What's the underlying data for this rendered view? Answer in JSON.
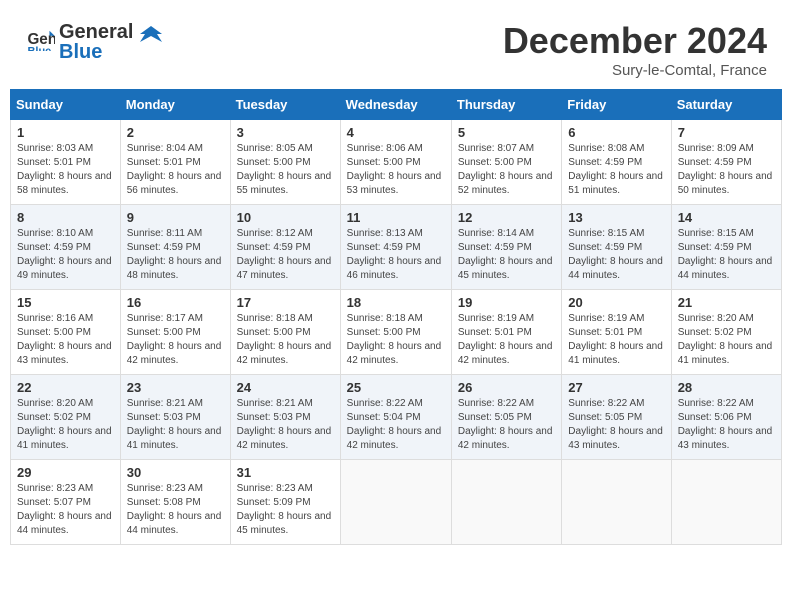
{
  "header": {
    "logo_general": "General",
    "logo_blue": "Blue",
    "month": "December 2024",
    "location": "Sury-le-Comtal, France"
  },
  "weekdays": [
    "Sunday",
    "Monday",
    "Tuesday",
    "Wednesday",
    "Thursday",
    "Friday",
    "Saturday"
  ],
  "weeks": [
    [
      {
        "day": "1",
        "sunrise": "Sunrise: 8:03 AM",
        "sunset": "Sunset: 5:01 PM",
        "daylight": "Daylight: 8 hours and 58 minutes."
      },
      {
        "day": "2",
        "sunrise": "Sunrise: 8:04 AM",
        "sunset": "Sunset: 5:01 PM",
        "daylight": "Daylight: 8 hours and 56 minutes."
      },
      {
        "day": "3",
        "sunrise": "Sunrise: 8:05 AM",
        "sunset": "Sunset: 5:00 PM",
        "daylight": "Daylight: 8 hours and 55 minutes."
      },
      {
        "day": "4",
        "sunrise": "Sunrise: 8:06 AM",
        "sunset": "Sunset: 5:00 PM",
        "daylight": "Daylight: 8 hours and 53 minutes."
      },
      {
        "day": "5",
        "sunrise": "Sunrise: 8:07 AM",
        "sunset": "Sunset: 5:00 PM",
        "daylight": "Daylight: 8 hours and 52 minutes."
      },
      {
        "day": "6",
        "sunrise": "Sunrise: 8:08 AM",
        "sunset": "Sunset: 4:59 PM",
        "daylight": "Daylight: 8 hours and 51 minutes."
      },
      {
        "day": "7",
        "sunrise": "Sunrise: 8:09 AM",
        "sunset": "Sunset: 4:59 PM",
        "daylight": "Daylight: 8 hours and 50 minutes."
      }
    ],
    [
      {
        "day": "8",
        "sunrise": "Sunrise: 8:10 AM",
        "sunset": "Sunset: 4:59 PM",
        "daylight": "Daylight: 8 hours and 49 minutes."
      },
      {
        "day": "9",
        "sunrise": "Sunrise: 8:11 AM",
        "sunset": "Sunset: 4:59 PM",
        "daylight": "Daylight: 8 hours and 48 minutes."
      },
      {
        "day": "10",
        "sunrise": "Sunrise: 8:12 AM",
        "sunset": "Sunset: 4:59 PM",
        "daylight": "Daylight: 8 hours and 47 minutes."
      },
      {
        "day": "11",
        "sunrise": "Sunrise: 8:13 AM",
        "sunset": "Sunset: 4:59 PM",
        "daylight": "Daylight: 8 hours and 46 minutes."
      },
      {
        "day": "12",
        "sunrise": "Sunrise: 8:14 AM",
        "sunset": "Sunset: 4:59 PM",
        "daylight": "Daylight: 8 hours and 45 minutes."
      },
      {
        "day": "13",
        "sunrise": "Sunrise: 8:15 AM",
        "sunset": "Sunset: 4:59 PM",
        "daylight": "Daylight: 8 hours and 44 minutes."
      },
      {
        "day": "14",
        "sunrise": "Sunrise: 8:15 AM",
        "sunset": "Sunset: 4:59 PM",
        "daylight": "Daylight: 8 hours and 44 minutes."
      }
    ],
    [
      {
        "day": "15",
        "sunrise": "Sunrise: 8:16 AM",
        "sunset": "Sunset: 5:00 PM",
        "daylight": "Daylight: 8 hours and 43 minutes."
      },
      {
        "day": "16",
        "sunrise": "Sunrise: 8:17 AM",
        "sunset": "Sunset: 5:00 PM",
        "daylight": "Daylight: 8 hours and 42 minutes."
      },
      {
        "day": "17",
        "sunrise": "Sunrise: 8:18 AM",
        "sunset": "Sunset: 5:00 PM",
        "daylight": "Daylight: 8 hours and 42 minutes."
      },
      {
        "day": "18",
        "sunrise": "Sunrise: 8:18 AM",
        "sunset": "Sunset: 5:00 PM",
        "daylight": "Daylight: 8 hours and 42 minutes."
      },
      {
        "day": "19",
        "sunrise": "Sunrise: 8:19 AM",
        "sunset": "Sunset: 5:01 PM",
        "daylight": "Daylight: 8 hours and 42 minutes."
      },
      {
        "day": "20",
        "sunrise": "Sunrise: 8:19 AM",
        "sunset": "Sunset: 5:01 PM",
        "daylight": "Daylight: 8 hours and 41 minutes."
      },
      {
        "day": "21",
        "sunrise": "Sunrise: 8:20 AM",
        "sunset": "Sunset: 5:02 PM",
        "daylight": "Daylight: 8 hours and 41 minutes."
      }
    ],
    [
      {
        "day": "22",
        "sunrise": "Sunrise: 8:20 AM",
        "sunset": "Sunset: 5:02 PM",
        "daylight": "Daylight: 8 hours and 41 minutes."
      },
      {
        "day": "23",
        "sunrise": "Sunrise: 8:21 AM",
        "sunset": "Sunset: 5:03 PM",
        "daylight": "Daylight: 8 hours and 41 minutes."
      },
      {
        "day": "24",
        "sunrise": "Sunrise: 8:21 AM",
        "sunset": "Sunset: 5:03 PM",
        "daylight": "Daylight: 8 hours and 42 minutes."
      },
      {
        "day": "25",
        "sunrise": "Sunrise: 8:22 AM",
        "sunset": "Sunset: 5:04 PM",
        "daylight": "Daylight: 8 hours and 42 minutes."
      },
      {
        "day": "26",
        "sunrise": "Sunrise: 8:22 AM",
        "sunset": "Sunset: 5:05 PM",
        "daylight": "Daylight: 8 hours and 42 minutes."
      },
      {
        "day": "27",
        "sunrise": "Sunrise: 8:22 AM",
        "sunset": "Sunset: 5:05 PM",
        "daylight": "Daylight: 8 hours and 43 minutes."
      },
      {
        "day": "28",
        "sunrise": "Sunrise: 8:22 AM",
        "sunset": "Sunset: 5:06 PM",
        "daylight": "Daylight: 8 hours and 43 minutes."
      }
    ],
    [
      {
        "day": "29",
        "sunrise": "Sunrise: 8:23 AM",
        "sunset": "Sunset: 5:07 PM",
        "daylight": "Daylight: 8 hours and 44 minutes."
      },
      {
        "day": "30",
        "sunrise": "Sunrise: 8:23 AM",
        "sunset": "Sunset: 5:08 PM",
        "daylight": "Daylight: 8 hours and 44 minutes."
      },
      {
        "day": "31",
        "sunrise": "Sunrise: 8:23 AM",
        "sunset": "Sunset: 5:09 PM",
        "daylight": "Daylight: 8 hours and 45 minutes."
      },
      null,
      null,
      null,
      null
    ]
  ]
}
